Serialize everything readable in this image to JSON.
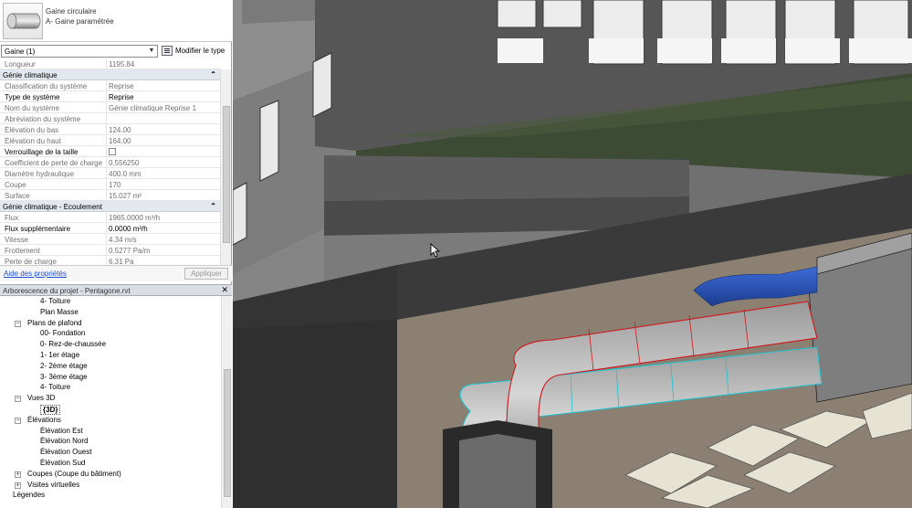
{
  "type_selector": {
    "family": "Gaine circulaire",
    "name": "A- Gaine paramétrée"
  },
  "instance_selector": {
    "value": "Gaine (1)",
    "edit_type_label": "Modifier le type"
  },
  "properties": {
    "top_rows": [
      {
        "key": "Longueur",
        "value": "1195.84"
      }
    ],
    "section_genie": "Génie climatique",
    "genie_rows": [
      {
        "key": "Classification du système",
        "value": "Reprise",
        "bold": false
      },
      {
        "key": "Type de système",
        "value": "Reprise",
        "bold": true
      },
      {
        "key": "Nom du système",
        "value": "Génie climatique Reprise 1",
        "bold": false
      },
      {
        "key": "Abréviation du système",
        "value": "",
        "bold": false
      },
      {
        "key": "Élévation du bas",
        "value": "124.00",
        "bold": false
      },
      {
        "key": "Élévation du haut",
        "value": "164.00",
        "bold": false
      },
      {
        "key": "Verrouillage de la taille",
        "value": "",
        "bold": true,
        "checkbox": true
      },
      {
        "key": "Coefficient de perte de charge",
        "value": "0.556250",
        "bold": false
      },
      {
        "key": "Diamètre hydraulique",
        "value": "400.0 mm",
        "bold": false
      },
      {
        "key": "Coupe",
        "value": "170",
        "bold": false
      },
      {
        "key": "Surface",
        "value": "15.027 m²",
        "bold": false
      }
    ],
    "section_flow": "Génie climatique - Ecoulement",
    "flow_rows": [
      {
        "key": "Flux",
        "value": "1965.0000 m³/h",
        "bold": false
      },
      {
        "key": "Flux supplémentaire",
        "value": "0.0000 m³/h",
        "bold": true
      },
      {
        "key": "Vitesse",
        "value": "4.34 m/s",
        "bold": false
      },
      {
        "key": "Frottement",
        "value": "0.5277 Pa/m",
        "bold": false
      },
      {
        "key": "Perte de charge",
        "value": "6.31 Pa",
        "bold": false
      }
    ],
    "help_link": "Aide des propriétés",
    "apply_label": "Appliquer"
  },
  "project_browser": {
    "title": "Arborescence du projet - Pentagone.rvt",
    "items": [
      {
        "label": "4- Toiture",
        "level": 3,
        "toggle": ""
      },
      {
        "label": "Plan Masse",
        "level": 3,
        "toggle": ""
      },
      {
        "label": "Plans de plafond",
        "level": 1,
        "toggle": "−"
      },
      {
        "label": "00- Fondation",
        "level": 3,
        "toggle": ""
      },
      {
        "label": "0- Rez-de-chaussée",
        "level": 3,
        "toggle": ""
      },
      {
        "label": "1- 1er étage",
        "level": 3,
        "toggle": ""
      },
      {
        "label": "2- 2ème étage",
        "level": 3,
        "toggle": ""
      },
      {
        "label": "3- 3ème étage",
        "level": 3,
        "toggle": ""
      },
      {
        "label": "4- Toiture",
        "level": 3,
        "toggle": ""
      },
      {
        "label": "Vues 3D",
        "level": 1,
        "toggle": "−"
      },
      {
        "label": "{3D}",
        "level": 3,
        "toggle": "",
        "selected": true
      },
      {
        "label": "Élévations",
        "level": 1,
        "toggle": "−"
      },
      {
        "label": "Élévation Est",
        "level": 3,
        "toggle": ""
      },
      {
        "label": "Élévation Nord",
        "level": 3,
        "toggle": ""
      },
      {
        "label": "Élévation Ouest",
        "level": 3,
        "toggle": ""
      },
      {
        "label": "Élévation Sud",
        "level": 3,
        "toggle": ""
      },
      {
        "label": "Coupes (Coupe du bâtiment)",
        "level": 1,
        "toggle": "+"
      },
      {
        "label": "Visites virtuelles",
        "level": 1,
        "toggle": "+"
      },
      {
        "label": "Légendes",
        "level": 0,
        "toggle": ""
      }
    ]
  },
  "colors": {
    "selected_duct": "#d0161c",
    "cyan_duct": "#19c4d4",
    "supply_duct": "#2f58c8",
    "section_header": "#e3e8ee"
  },
  "icons": {
    "type_thumbnail": "round-duct-icon",
    "edit_type": "edit-type-icon",
    "cursor": "arrow-cursor-icon"
  }
}
